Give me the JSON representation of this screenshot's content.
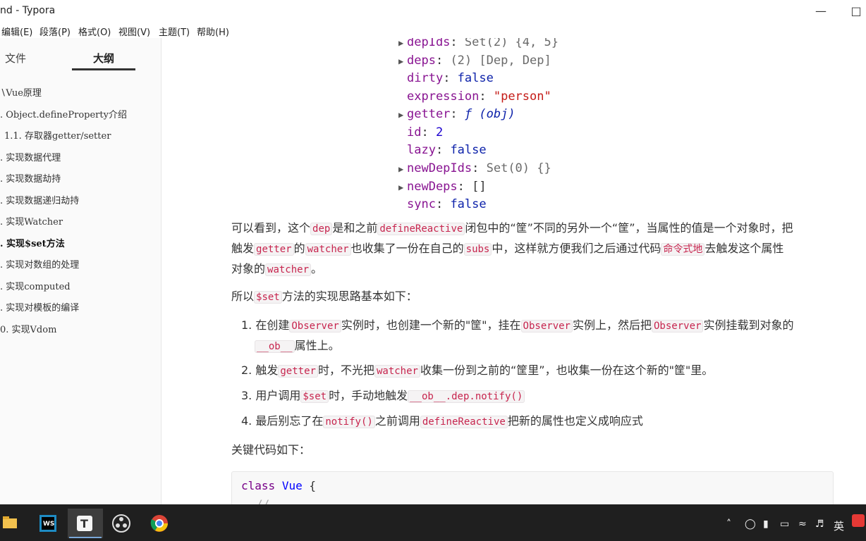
{
  "window": {
    "title": "nd - Typora"
  },
  "menu": [
    "编辑(E)",
    "段落(P)",
    "格式(O)",
    "视图(V)",
    "主题(T)",
    "帮助(H)"
  ],
  "sidebar": {
    "tabs": {
      "files": "文件",
      "outline": "大纲"
    },
    "outline": [
      "Vue原理",
      ". Object.defineProperty介绍",
      "1.1. 存取器getter/setter",
      ". 实现数据代理",
      ". 实现数据劫持",
      ". 实现数据递归劫持",
      ". 实现Watcher",
      ". 实现$set方法",
      ". 实现对数组的处理",
      ". 实现computed",
      ". 实现对模板的编译",
      "0. 实现Vdom"
    ]
  },
  "object_view": {
    "depIds": {
      "key": "depIds",
      "value": "Set(2) {4, 5}"
    },
    "deps": {
      "key": "deps",
      "value": "(2) [Dep, Dep]"
    },
    "dirty": {
      "key": "dirty",
      "value": "false"
    },
    "expression": {
      "key": "expression",
      "value": "\"person\""
    },
    "getter": {
      "key": "getter",
      "value": "ƒ (obj)"
    },
    "id": {
      "key": "id",
      "value": "2"
    },
    "lazy": {
      "key": "lazy",
      "value": "false"
    },
    "newDepIds": {
      "key": "newDepIds",
      "value": "Set(0) {}"
    },
    "newDeps": {
      "key": "newDeps",
      "value": "[]"
    },
    "sync": {
      "key": "sync",
      "value": "false"
    }
  },
  "content": {
    "p1": {
      "a": "可以看到，这个",
      "c1": "dep",
      "b": "是和之前",
      "c2": "defineReactive",
      "d": "闭包中的“筐”不同的另外一个“筐”，当属性的值是一个对象时，把",
      "e": "触发",
      "c3": "getter",
      "f": "的",
      "c4": "watcher",
      "g": "也收集了一份在自己的",
      "c5": "subs",
      "h": "中，这样就方便我们之后通过代码",
      "c6": "命令式地",
      "i": "去触发这个属性",
      "j": "对象的",
      "c7": "watcher",
      "k": "。"
    },
    "p2": {
      "a": "所以",
      "c1": "$set",
      "b": "方法的实现思路基本如下："
    },
    "list": {
      "l1": {
        "num": "1.",
        "a": "在创建",
        "c1": "Observer",
        "b": "实例时，也创建一个新的\"筐\"，挂在",
        "c2": "Observer",
        "c": "实例上，然后把",
        "c3": "Observer",
        "d": "实例挂载到对象的",
        "c4": "__ob__",
        "e": "属性上。"
      },
      "l2": {
        "num": "2.",
        "a": "触发",
        "c1": "getter",
        "b": "时，不光把",
        "c2": "watcher",
        "c": "收集一份到之前的“筐里”，也收集一份在这个新的\"筐\"里。"
      },
      "l3": {
        "num": "3.",
        "a": "用户调用",
        "c1": "$set",
        "b": "时，手动地触发",
        "c2": "__ob__.dep.notify()"
      },
      "l4": {
        "num": "4.",
        "a": "最后别忘了在",
        "c1": "notify()",
        "b": "之前调用",
        "c2": "defineReactive",
        "c": "把新的属性也定义成响应式"
      }
    },
    "p3": "关键代码如下：",
    "code": {
      "kw": "class",
      "name": "Vue",
      "brace": "{",
      "comment": "//..."
    }
  },
  "taskbar": {
    "ime": "英"
  }
}
